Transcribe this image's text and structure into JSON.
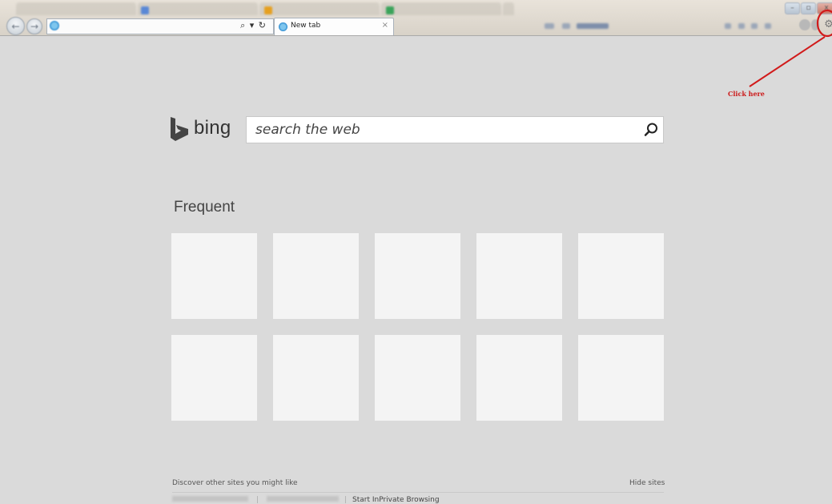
{
  "browser": {
    "active_tab_title": "New tab",
    "tab_close_glyph": "×",
    "address_tools": "⌕ ▾ ↻",
    "icons": {
      "back": "back-arrow-icon",
      "forward": "forward-arrow-icon",
      "ie_logo": "ie-logo-icon",
      "tools_gear": "gear-icon",
      "home": "home-icon",
      "favorites": "star-icon"
    }
  },
  "annotation": {
    "label": "Click here",
    "color": "#cc1a1a"
  },
  "newtab": {
    "brand": "bing",
    "search_placeholder": "search the web",
    "section_title": "Frequent",
    "tile_count": 10,
    "discover_text": "Discover other sites you might like",
    "hide_sites_label": "Hide sites",
    "footer_inprivate": "Start InPrivate Browsing"
  },
  "colors": {
    "page_bg": "#dadada",
    "tile_bg": "#f4f4f4",
    "bing_logo": "#444444",
    "annotation_red": "#cc1a1a"
  }
}
